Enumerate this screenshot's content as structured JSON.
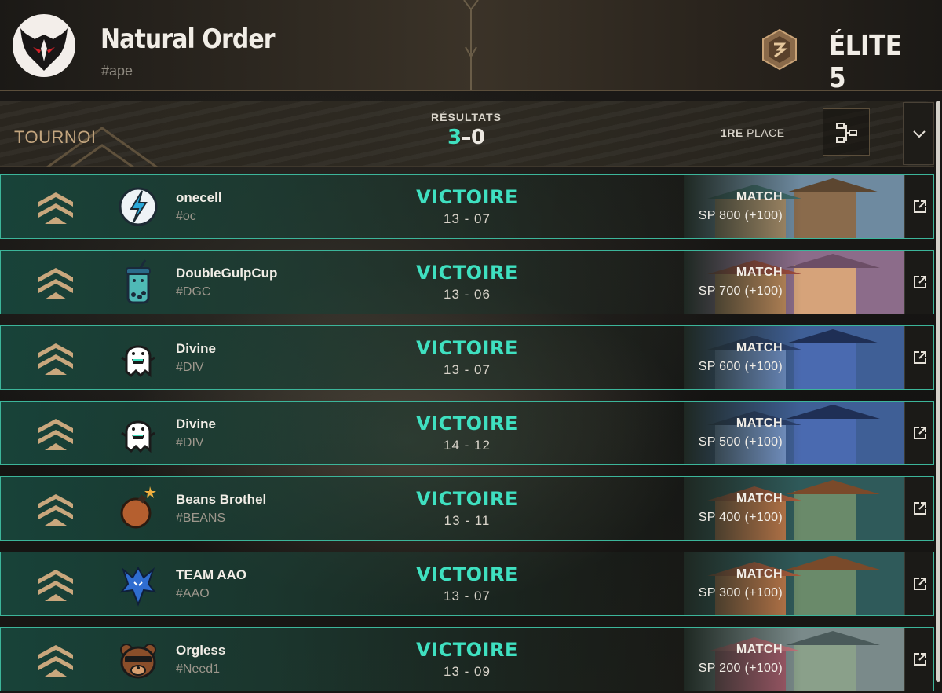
{
  "header": {
    "team_name": "Natural Order",
    "team_tag": "#ape",
    "rank": "ÉLITE 5"
  },
  "tournament": {
    "label": "TOURNOI",
    "results_label": "RÉSULTATS",
    "wins": "3",
    "losses": "0",
    "place_prefix": "1RE",
    "place_suffix": "PLACE"
  },
  "colors": {
    "accent": "#3fe0c0",
    "gold": "#c3a57e",
    "row_border": "#3cb59a"
  },
  "matches": [
    {
      "opponent": "onecell",
      "tag": "#oc",
      "result": "VICTOIRE",
      "score": "13 - 07",
      "match_label": "MATCH",
      "sp": "SP 800 (+100)",
      "logo": "lightning-logo-icon"
    },
    {
      "opponent": "DoubleGulpCup",
      "tag": "#DGC",
      "result": "VICTOIRE",
      "score": "13 - 06",
      "match_label": "MATCH",
      "sp": "SP 700 (+100)",
      "logo": "boba-cup-logo-icon"
    },
    {
      "opponent": "Divine",
      "tag": "#DIV",
      "result": "VICTOIRE",
      "score": "13 - 07",
      "match_label": "MATCH",
      "sp": "SP 600 (+100)",
      "logo": "ghost-logo-icon"
    },
    {
      "opponent": "Divine",
      "tag": "#DIV",
      "result": "VICTOIRE",
      "score": "14 - 12",
      "match_label": "MATCH",
      "sp": "SP 500 (+100)",
      "logo": "ghost-logo-icon"
    },
    {
      "opponent": "Beans Brothel",
      "tag": "#BEANS",
      "result": "VICTOIRE",
      "score": "13 - 11",
      "match_label": "MATCH",
      "sp": "SP 400 (+100)",
      "logo": "bomb-logo-icon"
    },
    {
      "opponent": "TEAM AAO",
      "tag": "#AAO",
      "result": "VICTOIRE",
      "score": "13 - 07",
      "match_label": "MATCH",
      "sp": "SP 300 (+100)",
      "logo": "dragon-logo-icon"
    },
    {
      "opponent": "Orgless",
      "tag": "#Need1",
      "result": "VICTOIRE",
      "score": "13 - 09",
      "match_label": "MATCH",
      "sp": "SP 200 (+100)",
      "logo": "bear-logo-icon"
    }
  ]
}
